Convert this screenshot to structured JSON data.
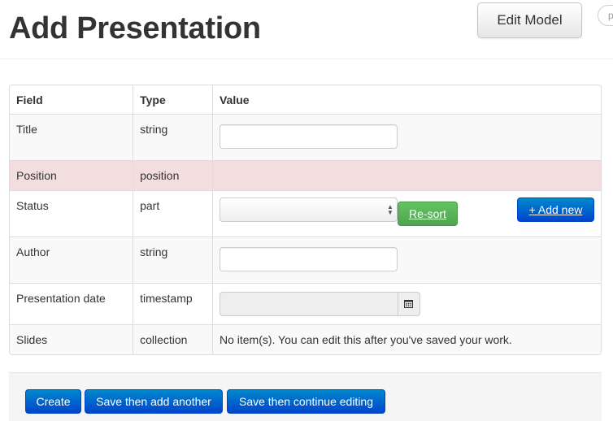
{
  "header": {
    "title": "Add Presentation",
    "edit_model_label": "Edit Model",
    "partial_pill_text": "p"
  },
  "table": {
    "columns": [
      "Field",
      "Type",
      "Value"
    ],
    "rows": [
      {
        "field": "Title",
        "type": "string",
        "value": ""
      },
      {
        "field": "Position",
        "type": "position",
        "value": ""
      },
      {
        "field": "Status",
        "type": "part",
        "value": ""
      },
      {
        "field": "Author",
        "type": "string",
        "value": ""
      },
      {
        "field": "Presentation date",
        "type": "timestamp",
        "value": ""
      },
      {
        "field": "Slides",
        "type": "collection",
        "value": "No item(s). You can edit this after you've saved your work."
      }
    ]
  },
  "status_controls": {
    "resort_label": "Re-sort",
    "add_new_label": "+ Add new"
  },
  "icons": {
    "select_arrows": "select-updown-icon",
    "date_picker": "calendar-icon"
  },
  "footer": {
    "create_label": "Create",
    "save_add_another_label": "Save then add another",
    "save_continue_label": "Save then continue editing"
  },
  "colors": {
    "primary_button": "#0044cc",
    "success_button": "#51a351",
    "error_row": "#f2dede"
  }
}
